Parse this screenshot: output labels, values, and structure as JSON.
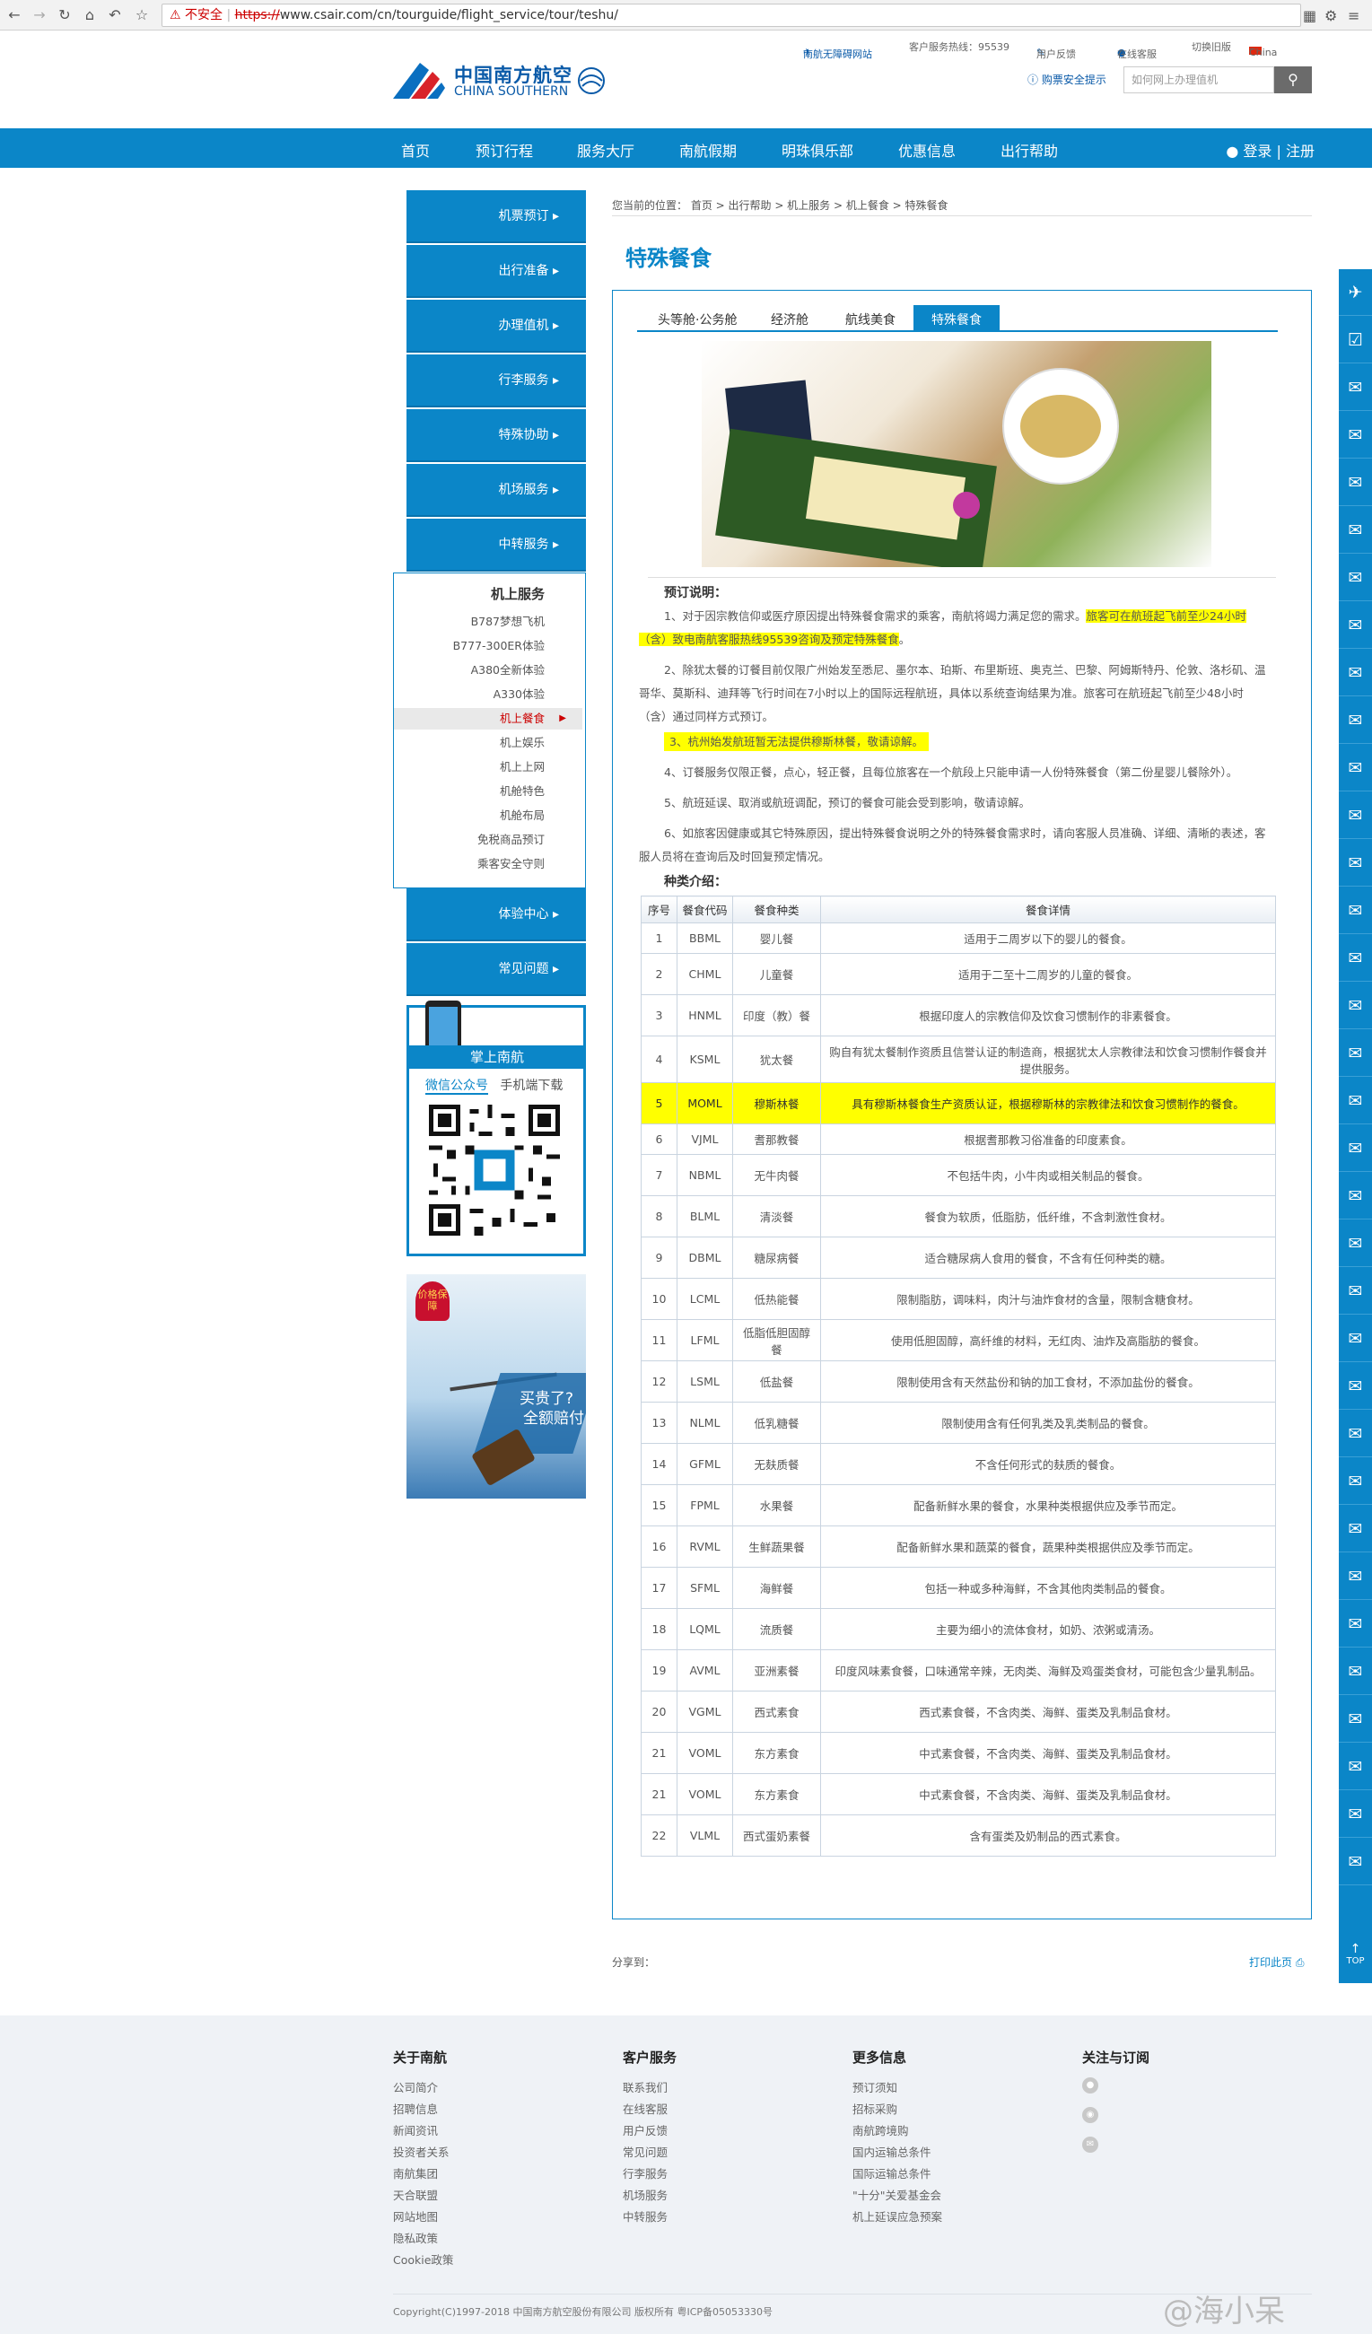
{
  "browser": {
    "insecure_label": "不安全",
    "url_scheme": "https://",
    "url_rest": "www.csair.com/cn/tourguide/flight_service/tour/teshu/"
  },
  "topbar": {
    "link1": "南航无障碍网站",
    "hotline": "客户服务热线：95539",
    "feedback": "用户反馈",
    "online": "在线客服",
    "old_version": "切换旧版",
    "region": "China"
  },
  "logo": {
    "cn": "中国南方航空",
    "en": "CHINA SOUTHERN"
  },
  "header": {
    "safety_link": "购票安全提示",
    "search_placeholder": "如何网上办理值机"
  },
  "nav": {
    "items": [
      "首页",
      "预订行程",
      "服务大厅",
      "南航假期",
      "明珠俱乐部",
      "优惠信息",
      "出行帮助"
    ],
    "login": "登录 | 注册"
  },
  "sidebar": {
    "blocks": [
      "机票预订",
      "出行准备",
      "办理值机",
      "行李服务",
      "特殊协助",
      "机场服务",
      "中转服务"
    ],
    "sub_title": "机上服务",
    "sub_items": [
      "B787梦想飞机",
      "B777-300ER体验",
      "A380全新体验",
      "A330体验",
      "机上餐食",
      "机上娱乐",
      "机上上网",
      "机舱特色",
      "机舱布局",
      "免税商品预订",
      "乘客安全守则"
    ],
    "blocks2": [
      "体验中心",
      "常见问题"
    ]
  },
  "app_box": {
    "title": "掌上南航",
    "tab1": "微信公众号",
    "tab2": "手机端下载"
  },
  "ad": {
    "badge": "价格保障",
    "line1": "买贵了?",
    "line2": "全额赔付"
  },
  "breadcrumb": "您当前的位置： 首页 > 出行帮助 > 机上服务 > 机上餐食 > 特殊餐食",
  "page_title": "特殊餐食",
  "tabs": [
    "头等舱·公务舱",
    "经济舱",
    "航线美食",
    "特殊餐食"
  ],
  "notes": {
    "heading": "预订说明：",
    "n1a": "1、对于因宗教信仰或医疗原因提出特殊餐食需求的乘客，南航将竭力满足您的需求。",
    "n1b": "旅客可在航班起飞前至少24小时（含）致电南航客服热线95539咨询及预定特殊餐食",
    "n1c": "。",
    "n2": "2、除犹太餐的订餐目前仅限广州始发至悉尼、墨尔本、珀斯、布里斯班、奥克兰、巴黎、阿姆斯特丹、伦敦、洛杉矶、温哥华、莫斯科、迪拜等飞行时间在7小时以上的国际远程航班，具体以系统查询结果为准。旅客可在航班起飞前至少48小时（含）通过同样方式预订。",
    "n3": "3、杭州始发航班暂无法提供穆斯林餐，敬请谅解。",
    "n4": "4、订餐服务仅限正餐，点心，轻正餐，且每位旅客在一个航段上只能申请一人份特殊餐食（第二份星婴儿餐除外）。",
    "n5": "5、航班延误、取消或航班调配，预订的餐食可能会受到影响，敬请谅解。",
    "n6": "6、如旅客因健康或其它特殊原因，提出特殊餐食说明之外的特殊餐食需求时，请向客服人员准确、详细、清晰的表述，客服人员将在查询后及时回复预定情况。"
  },
  "types_heading": "种类介绍：",
  "table": {
    "headers": [
      "序号",
      "餐食代码",
      "餐食种类",
      "餐食详情"
    ],
    "rows": [
      [
        "1",
        "BBML",
        "婴儿餐",
        "适用于二周岁以下的婴儿的餐食。"
      ],
      [
        "2",
        "CHML",
        "儿童餐",
        "适用于二至十二周岁的儿童的餐食。"
      ],
      [
        "3",
        "HNML",
        "印度（教）餐",
        "根据印度人的宗教信仰及饮食习惯制作的非素餐食。"
      ],
      [
        "4",
        "KSML",
        "犹太餐",
        "购自有犹太餐制作资质且信誉认证的制造商，根据犹太人宗教律法和饮食习惯制作餐食并提供服务。"
      ],
      [
        "5",
        "MOML",
        "穆斯林餐",
        "具有穆斯林餐食生产资质认证，根据穆斯林的宗教律法和饮食习惯制作的餐食。"
      ],
      [
        "6",
        "VJML",
        "耆那教餐",
        "根据耆那教习俗准备的印度素食。"
      ],
      [
        "7",
        "NBML",
        "无牛肉餐",
        "不包括牛肉，小牛肉或相关制品的餐食。"
      ],
      [
        "8",
        "BLML",
        "清淡餐",
        "餐食为软质，低脂肪，低纤维，不含刺激性食材。"
      ],
      [
        "9",
        "DBML",
        "糖尿病餐",
        "适合糖尿病人食用的餐食，不含有任何种类的糖。"
      ],
      [
        "10",
        "LCML",
        "低热能餐",
        "限制脂肪，调味料，肉汁与油炸食材的含量，限制含糖食材。"
      ],
      [
        "11",
        "LFML",
        "低脂低胆固醇餐",
        "使用低胆固醇，高纤维的材料，无红肉、油炸及高脂肪的餐食。"
      ],
      [
        "12",
        "LSML",
        "低盐餐",
        "限制使用含有天然盐份和钠的加工食材，不添加盐份的餐食。"
      ],
      [
        "13",
        "NLML",
        "低乳糖餐",
        "限制使用含有任何乳类及乳类制品的餐食。"
      ],
      [
        "14",
        "GFML",
        "无麸质餐",
        "不含任何形式的麸质的餐食。"
      ],
      [
        "15",
        "FPML",
        "水果餐",
        "配备新鲜水果的餐食，水果种类根据供应及季节而定。"
      ],
      [
        "16",
        "RVML",
        "生鲜蔬果餐",
        "配备新鲜水果和蔬菜的餐食，蔬果种类根据供应及季节而定。"
      ],
      [
        "17",
        "SFML",
        "海鲜餐",
        "包括一种或多种海鲜，不含其他肉类制品的餐食。"
      ],
      [
        "18",
        "LQML",
        "流质餐",
        "主要为细小的流体食材，如奶、浓粥或清汤。"
      ],
      [
        "19",
        "AVML",
        "亚洲素餐",
        "印度风味素食餐，口味通常辛辣，无肉类、海鲜及鸡蛋类食材，可能包含少量乳制品。"
      ],
      [
        "20",
        "VGML",
        "西式素食",
        "西式素食餐，不含肉类、海鲜、蛋类及乳制品食材。"
      ],
      [
        "21",
        "VOML",
        "东方素食",
        "中式素食餐，不含肉类、海鲜、蛋类及乳制品食材。"
      ],
      [
        "21",
        "VOML",
        "东方素食",
        "中式素食餐，不含肉类、海鲜、蛋类及乳制品食材。"
      ],
      [
        "22",
        "VLML",
        "西式蛋奶素餐",
        "含有蛋类及奶制品的西式素食。"
      ]
    ]
  },
  "share_label": "分享到：",
  "print_label": "打印此页",
  "right_bar": {
    "top_label": "TOP"
  },
  "footer": {
    "col1": {
      "title": "关于南航",
      "links": [
        "公司简介",
        "招聘信息",
        "新闻资讯",
        "投资者关系",
        "南航集团",
        "天合联盟",
        "网站地图",
        "隐私政策",
        "Cookie政策"
      ]
    },
    "col2": {
      "title": "客户服务",
      "links": [
        "联系我们",
        "在线客服",
        "用户反馈",
        "常见问题",
        "行李服务",
        "机场服务",
        "中转服务"
      ]
    },
    "col3": {
      "title": "更多信息",
      "links": [
        "预订须知",
        "招标采购",
        "南航跨境购",
        "国内运输总条件",
        "国际运输总条件",
        "\"十分\"关爱基金会",
        "机上延误应急预案"
      ]
    },
    "col4": {
      "title": "关注与订阅"
    },
    "copyright": "Copyright(C)1997-2018 中国南方航空股份有限公司 版权所有 粤ICP备05053330号"
  },
  "watermark": "@海小呆",
  "colors": {
    "brand_blue": "#0b86c8",
    "highlight": "#ffff00",
    "insecure_red": "#cc0000"
  }
}
